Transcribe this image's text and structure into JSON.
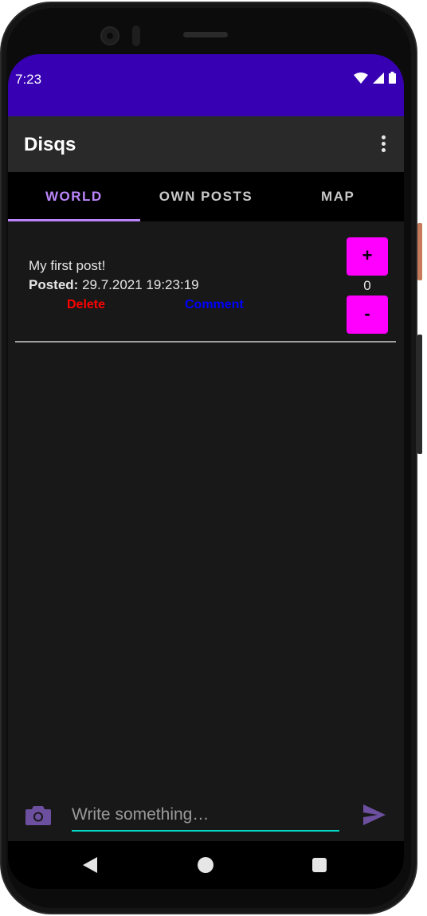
{
  "status_bar": {
    "time": "7:23"
  },
  "app_bar": {
    "title": "Disqs",
    "more_icon": "more-vert-icon"
  },
  "tabs": [
    {
      "label": "WORLD",
      "active": true
    },
    {
      "label": "OWN POSTS",
      "active": false
    },
    {
      "label": "MAP",
      "active": false
    }
  ],
  "posts": [
    {
      "text": "My first post!",
      "posted_label": "Posted:",
      "posted_value": "29.7.2021 19:23:19",
      "delete_label": "Delete",
      "comment_label": "Comment",
      "upvote_label": "+",
      "downvote_label": "-",
      "score": "0"
    }
  ],
  "compose": {
    "placeholder": "Write something…",
    "value": ""
  },
  "colors": {
    "status_bar": "#3700b3",
    "accent": "#bb86fc",
    "vote_button": "#ff00ff",
    "delete": "#ff0000",
    "comment": "#0000ff",
    "input_underline": "#03dac5"
  }
}
